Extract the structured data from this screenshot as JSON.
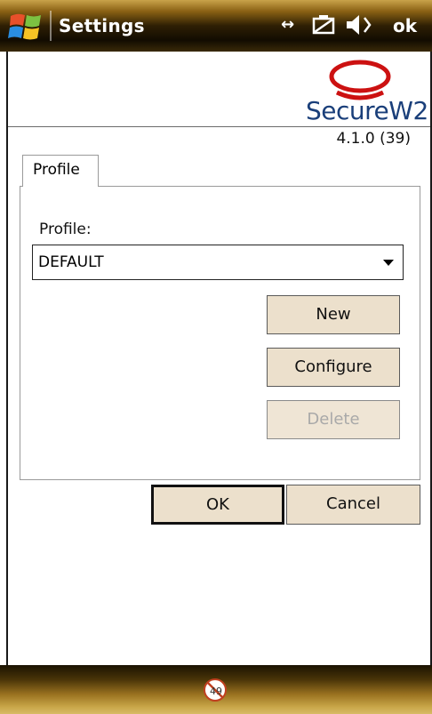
{
  "header": {
    "title": "Settings",
    "status_connectivity": "↔",
    "ok_label": "ok"
  },
  "icons": {
    "start": "windows-start-icon",
    "connectivity": "connectivity-icon",
    "battery": "battery-icon",
    "volume": "volume-icon",
    "sip": "keyboard-sip-icon"
  },
  "logo": {
    "text": "SecureW2",
    "brand_color": "#cc1111"
  },
  "version": "4.1.0 (39)",
  "tabs": [
    {
      "label": "Profile",
      "active": true
    }
  ],
  "profile": {
    "label": "Profile:",
    "selected": "DEFAULT"
  },
  "buttons": {
    "new": "New",
    "configure": "Configure",
    "delete": "Delete",
    "ok": "OK",
    "cancel": "Cancel"
  },
  "colors": {
    "button_bg": "#ece0cc",
    "bar_gold": "#c8a548",
    "disabled_text": "#a9a9a9"
  }
}
